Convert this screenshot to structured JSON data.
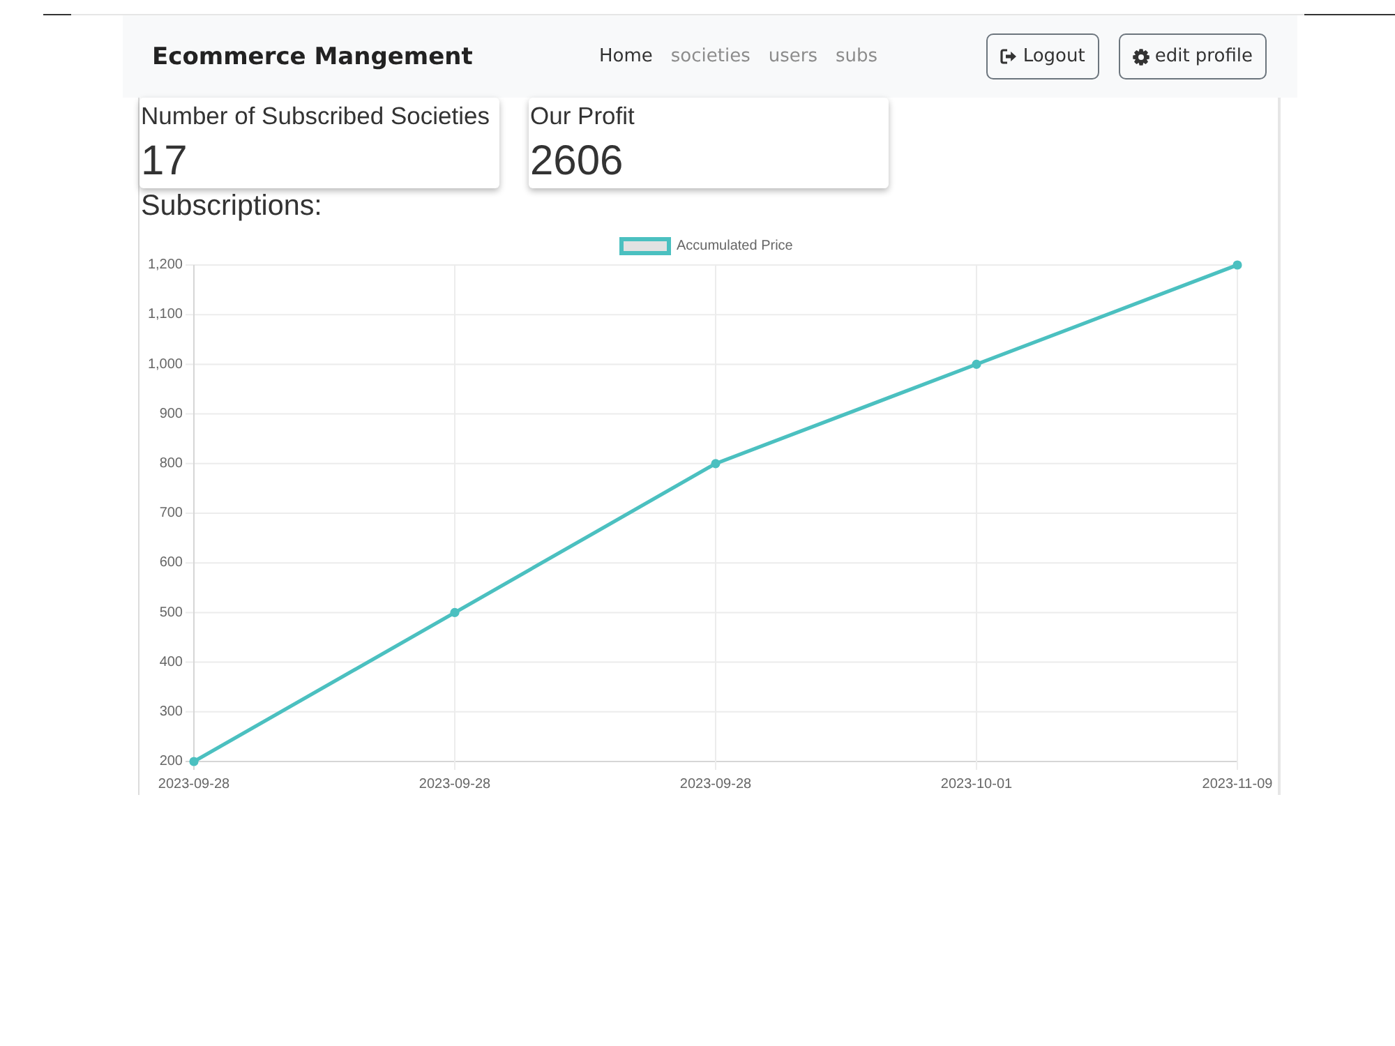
{
  "navbar": {
    "brand": "Ecommerce Mangement",
    "links": [
      {
        "label": "Home",
        "selected": true
      },
      {
        "label": "societies",
        "selected": false
      },
      {
        "label": "users",
        "selected": false
      },
      {
        "label": "subs",
        "selected": false
      }
    ],
    "buttons": [
      {
        "label": "Logout",
        "kind": "logout"
      },
      {
        "label": "edit profile",
        "kind": "settings"
      }
    ]
  },
  "stats": [
    {
      "label": "Number of Subscribed Societies",
      "value": "17"
    },
    {
      "label": "Our Profit",
      "value": "2606"
    }
  ],
  "subscriptions": {
    "heading": "Subscriptions:",
    "chart_data": {
      "type": "line",
      "grid": true,
      "categories": [
        "2023-09-28",
        "2023-09-28",
        "2023-09-28",
        "2023-10-01",
        "2023-11-09"
      ],
      "series": [
        {
          "name": "Accumulated Price",
          "color": "#4bc0c0",
          "marker": true,
          "values": [
            200,
            500,
            800,
            1000,
            1200
          ]
        }
      ],
      "ylim": [
        200,
        1200
      ],
      "yticks": [
        200,
        300,
        400,
        500,
        600,
        700,
        800,
        900,
        {
          "value": 1000,
          "label": "1,000"
        },
        {
          "value": 1100,
          "label": "1,100"
        },
        {
          "value": 1200,
          "label": "1,200"
        }
      ]
    }
  }
}
